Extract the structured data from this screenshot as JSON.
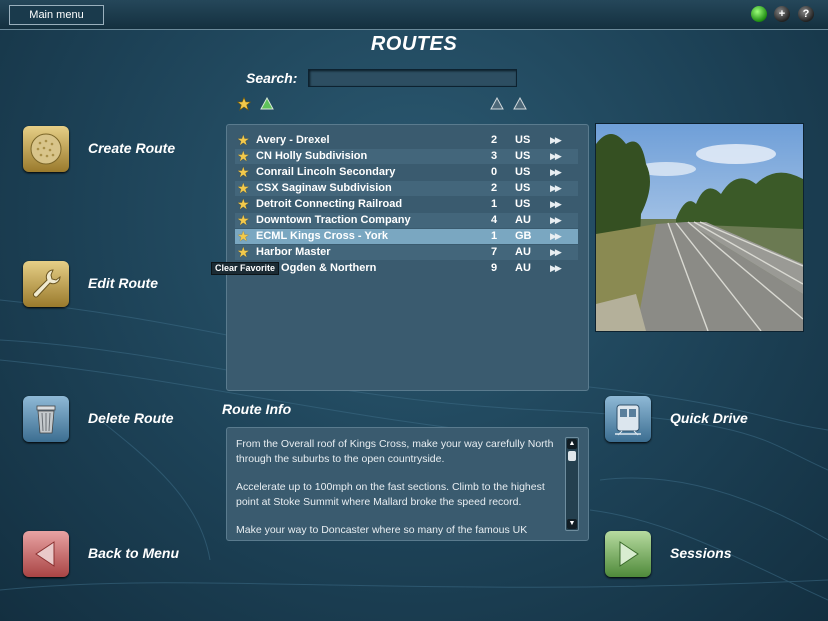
{
  "topbar": {
    "main_menu_label": "Main menu",
    "icons": [
      "status-green-icon",
      "plus-icon",
      "help-icon"
    ],
    "help_glyph": "?",
    "plus_glyph": "+"
  },
  "page_title": "ROUTES",
  "search": {
    "label": "Search:",
    "value": "",
    "placeholder": ""
  },
  "list_headers": {
    "favorite_sort_icon": "star-icon",
    "name_sort_icon": "triangle-up-icon",
    "number_sort_icon": "triangle-up-icon",
    "country_sort_icon": "triangle-up-icon"
  },
  "routes": [
    {
      "name": "Avery - Drexel",
      "num": "2",
      "country": "US"
    },
    {
      "name": "CN Holly Subdivision",
      "num": "3",
      "country": "US"
    },
    {
      "name": "Conrail Lincoln Secondary",
      "num": "0",
      "country": "US"
    },
    {
      "name": "CSX Saginaw Subdivision",
      "num": "2",
      "country": "US"
    },
    {
      "name": "Detroit Connecting Railroad",
      "num": "1",
      "country": "US"
    },
    {
      "name": "Downtown Traction Company",
      "num": "4",
      "country": "AU"
    },
    {
      "name": "ECML Kings Cross - York",
      "num": "1",
      "country": "GB"
    },
    {
      "name": "Harbor Master",
      "num": "7",
      "country": "AU"
    },
    {
      "name": "Port Ogden & Northern",
      "num": "9",
      "country": "AU"
    }
  ],
  "selected_route_index": 6,
  "row_action_glyph": "▶▶",
  "tooltip": "Clear Favorite",
  "info": {
    "title": "Route Info",
    "paragraphs": [
      "From the Overall roof of Kings Cross, make your way carefully North through the suburbs to the open countryside.",
      "Accelerate up to 100mph on the fast sections. Climb to the highest point at Stoke Summit where Mallard broke the speed record.",
      "Make your way to Doncaster where so many of the famous UK"
    ]
  },
  "buttons": {
    "create": "Create Route",
    "edit": "Edit Route",
    "delete": "Delete Route",
    "back": "Back to Menu",
    "quick": "Quick Drive",
    "sessions": "Sessions"
  },
  "colors": {
    "star": "#f2c94c",
    "selected_row": "#7aa7c1",
    "panel": "#3a5b6f"
  }
}
